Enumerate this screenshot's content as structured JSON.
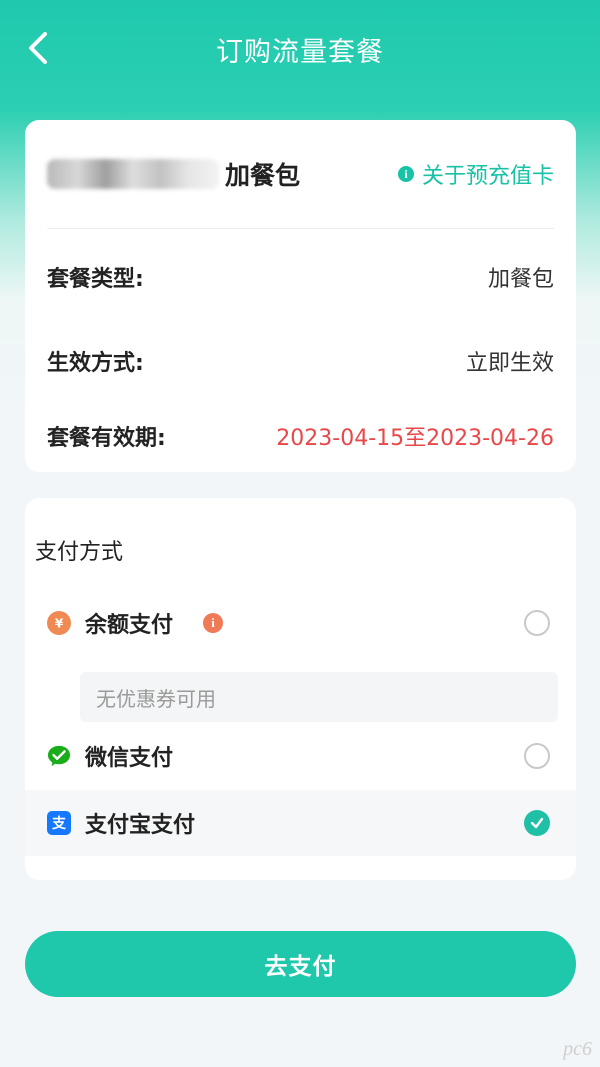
{
  "header": {
    "title": "订购流量套餐"
  },
  "package": {
    "name_suffix": "加餐包",
    "about_link": "关于预充值卡",
    "info_icon": "i",
    "rows": [
      {
        "key": "套餐类型:",
        "value": "加餐包"
      },
      {
        "key": "生效方式:",
        "value": "立即生效"
      },
      {
        "key": "套餐有效期:",
        "value": "2023-04-15至2023-04-26"
      }
    ]
  },
  "payment": {
    "title": "支付方式",
    "methods": [
      {
        "label": "余额支付",
        "icon": "money-bag-icon",
        "selected": false
      },
      {
        "label": "微信支付",
        "icon": "wechat-icon",
        "selected": false
      },
      {
        "label": "支付宝支付",
        "icon": "alipay-icon",
        "selected": true
      }
    ],
    "coupon_placeholder": "无优惠券可用",
    "balance_info_icon": "i"
  },
  "submit_button": "去支付",
  "watermark": "pc6",
  "colors": {
    "accent": "#1fc7ab",
    "danger": "#e8484a",
    "info_orange": "#f17a56",
    "wechat_green": "#1aad19",
    "alipay_blue": "#1677ff"
  }
}
